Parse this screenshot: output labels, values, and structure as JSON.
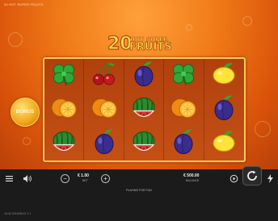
{
  "game": {
    "top_title": "20 HOT SUPER FRUITS",
    "logo_number": "20",
    "logo_line1": "HOT SUPER",
    "logo_line2": "FRUITS"
  },
  "reels": {
    "columns": 5,
    "rows": 3,
    "grid": [
      [
        "clover",
        "cherry",
        "plum",
        "clover",
        "lemon"
      ],
      [
        "orange",
        "orange",
        "watermelon",
        "orange",
        "plum"
      ],
      [
        "watermelon",
        "plum",
        "watermelon",
        "plum",
        "lemon"
      ]
    ]
  },
  "bonus_button": {
    "label": "BONUS"
  },
  "controls": {
    "bet_value": "€ 1.00",
    "bet_caption": "BET",
    "balance_value": "€ 500.00",
    "balance_caption": "BALANCE",
    "mode_text": "PLAYING FOR FUN",
    "footer_text": "16:42   2019/06/12 1.1"
  },
  "colors": {
    "background_orange": "#f07a17",
    "reel_frame": "#ffc957",
    "bar": "#1b1b1b"
  }
}
